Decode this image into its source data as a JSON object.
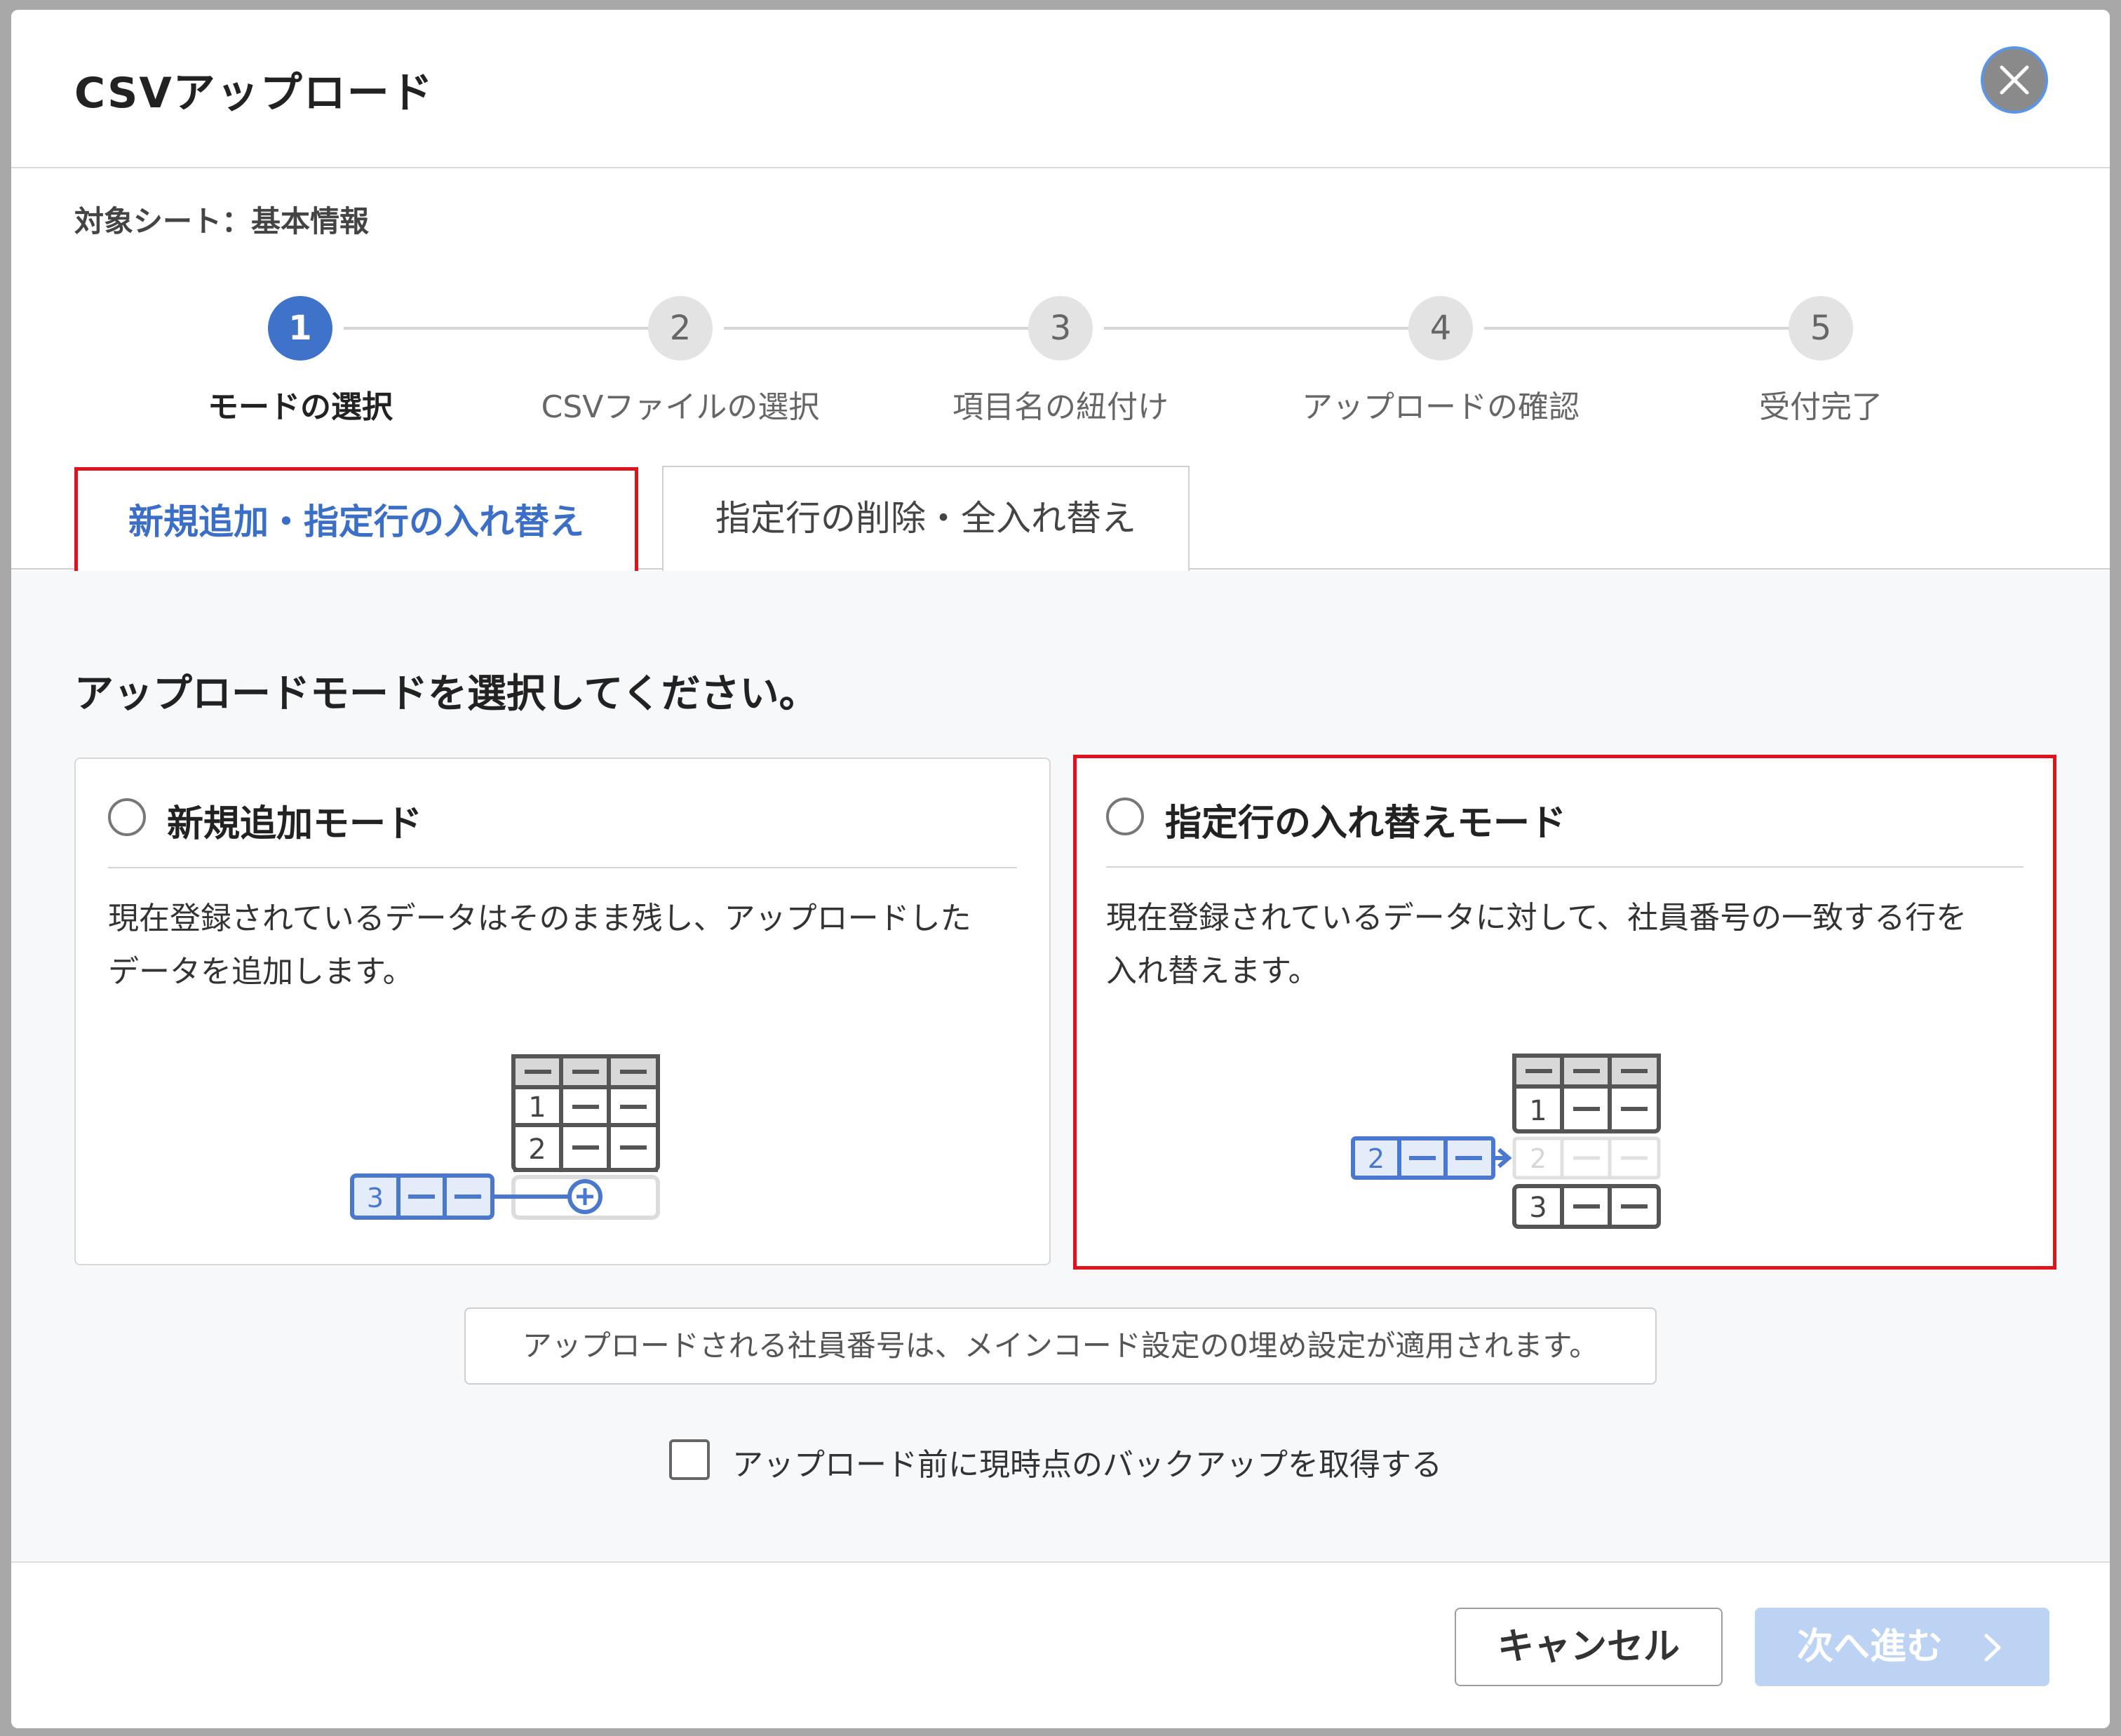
{
  "dialog": {
    "title": "CSVアップロード",
    "target_sheet": "対象シート：基本情報"
  },
  "steps": [
    {
      "number": "1",
      "label": "モードの選択",
      "active": true
    },
    {
      "number": "2",
      "label": "CSVファイルの選択",
      "active": false
    },
    {
      "number": "3",
      "label": "項目名の紐付け",
      "active": false
    },
    {
      "number": "4",
      "label": "アップロードの確認",
      "active": false
    },
    {
      "number": "5",
      "label": "受付完了",
      "active": false
    }
  ],
  "tabs": {
    "active": "新規追加・指定行の入れ替え",
    "inactive": "指定行の削除・全入れ替え"
  },
  "prompt": "アップロードモードを選択してください。",
  "modes": {
    "add": {
      "title": "新規追加モード",
      "desc_line1": "現在登録されているデータはそのまま残し、アップロードした",
      "desc_line2": "データを追加します。",
      "selected": false
    },
    "replace": {
      "title": "指定行の入れ替えモード",
      "desc_line1": "現在登録されているデータに対して、社員番号の一致する行を",
      "desc_line2": "入れ替えます。",
      "selected": false
    }
  },
  "illustrations": {
    "add": {
      "rows": [
        "1",
        "2"
      ],
      "new_row": "3"
    },
    "replace": {
      "rows": [
        "1",
        "3"
      ],
      "replaced_row": "2",
      "incoming_row": "2"
    }
  },
  "info_text": "アップロードされる社員番号は、メインコード設定の0埋め設定が適用されます。",
  "backup": {
    "label": "アップロード前に現時点のバックアップを取得する",
    "checked": false
  },
  "footer": {
    "cancel_label": "キャンセル",
    "next_label": "次へ進む"
  },
  "colors": {
    "accent": "#3f73c9",
    "highlight_border": "#e0121b",
    "next_disabled": "#bcd3f3"
  },
  "icons": {
    "close": "close-icon",
    "next": "chevron-right-icon"
  }
}
